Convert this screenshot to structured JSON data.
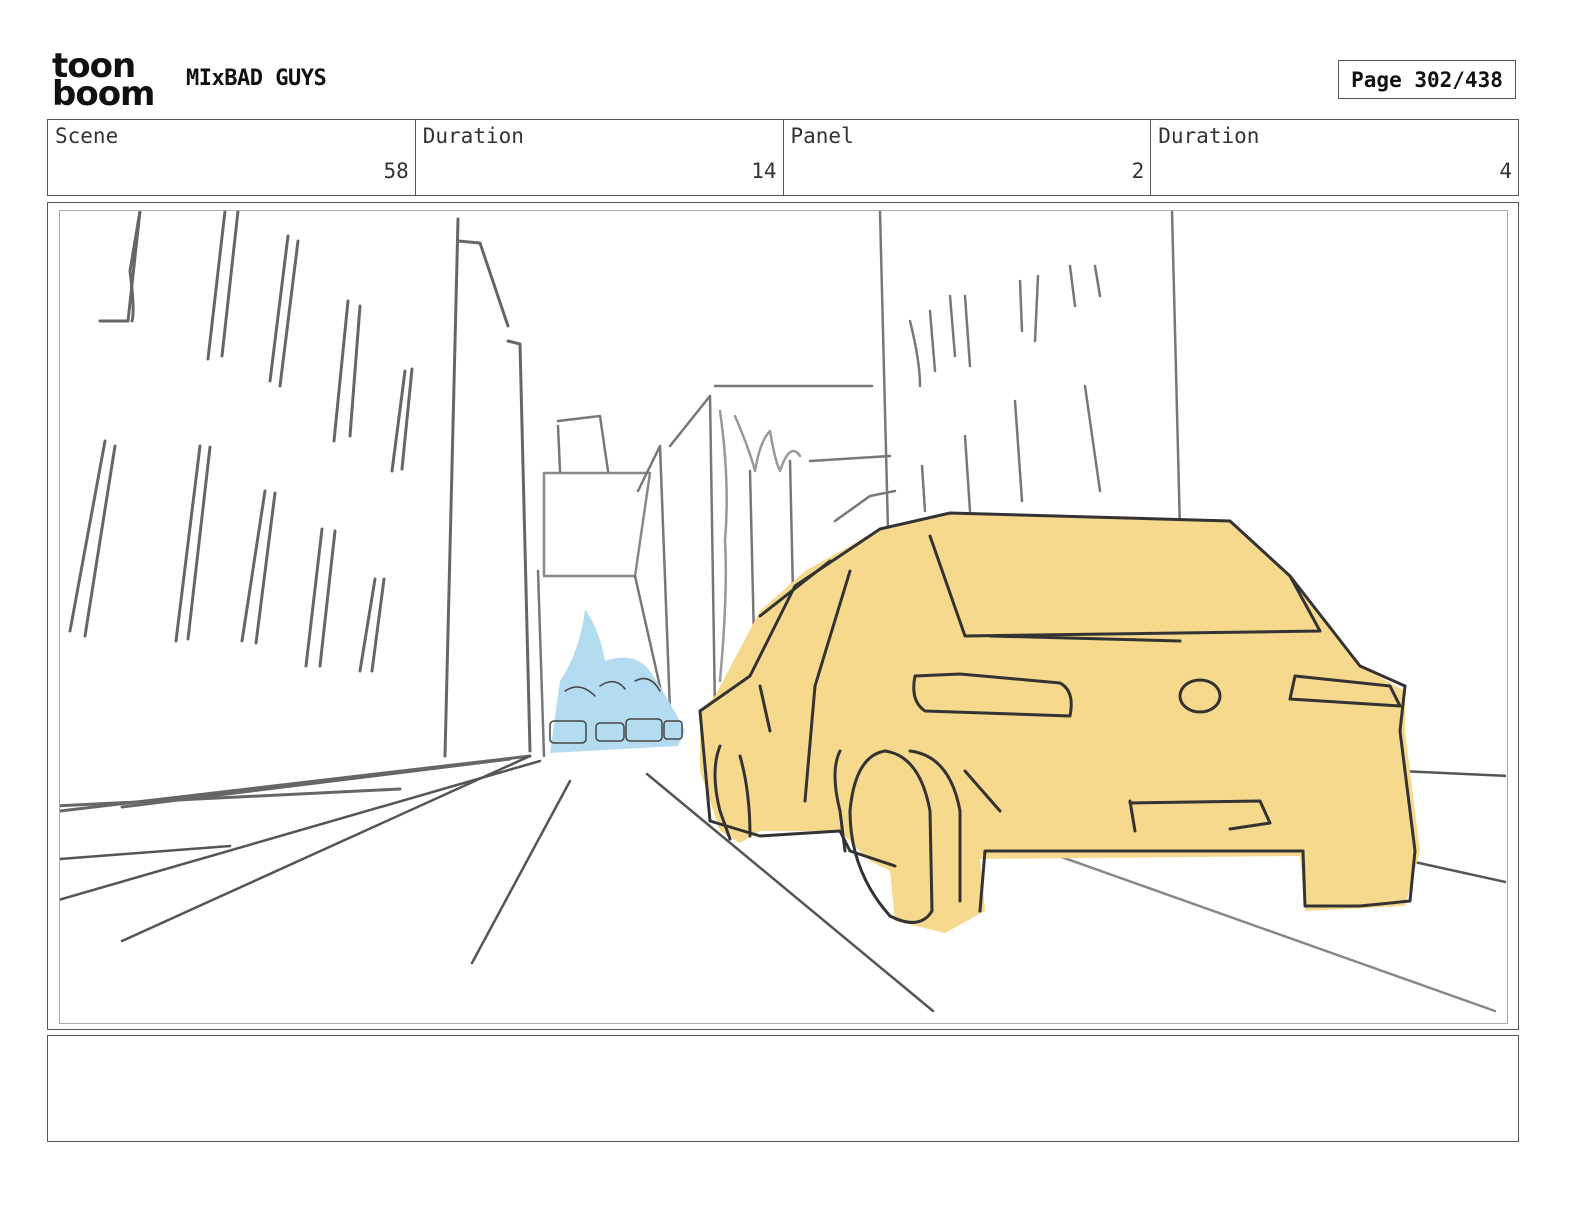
{
  "header": {
    "logo_top": "toon",
    "logo_bottom": "boom",
    "project_title": "MIxBAD GUYS",
    "page": "Page 302/438"
  },
  "info": {
    "scene_label": "Scene",
    "scene_value": "58",
    "scene_duration_label": "Duration",
    "scene_duration_value": "14",
    "panel_label": "Panel",
    "panel_value": "2",
    "panel_duration_label": "Duration",
    "panel_duration_value": "4"
  },
  "colors": {
    "car_fill": "#f7d98e",
    "traffic_fill": "#b3dcf0",
    "sketch_line": "#4a4a4a"
  },
  "notes": {
    "text": ""
  }
}
